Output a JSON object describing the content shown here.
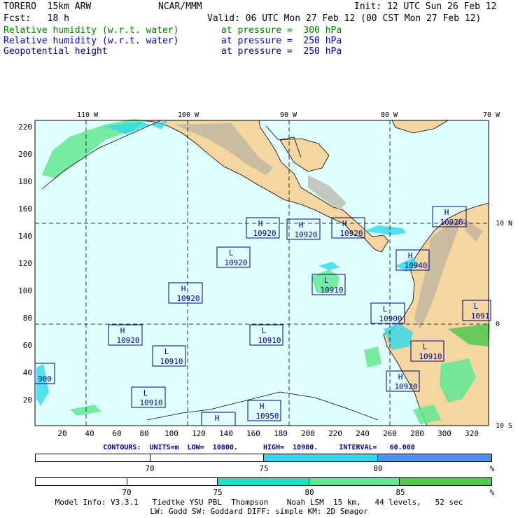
{
  "header": {
    "model": "TORERO  15km ARW",
    "org": "NCAR/MMM",
    "init": "Init: 12 UTC Sun 26 Feb 12",
    "fcst": "Fcst:   18 h",
    "valid": "Valid: 06 UTC Mon 27 Feb 12 (00 CST Mon 27 Feb 12)",
    "fields": [
      {
        "name": "Relative humidity (w.r.t. water)",
        "level": "at pressure =  300 hPa",
        "color": "#008000"
      },
      {
        "name": "Relative humidity (w.r.t. water)",
        "level": "at pressure =  250 hPa",
        "color": "#0000c0"
      },
      {
        "name": "Geopotential height",
        "level": "at pressure =  250 hPa",
        "color": "#000080"
      }
    ]
  },
  "map": {
    "lon_labels": [
      "110 W",
      "100 W",
      "90 W",
      "80 W",
      "70 W"
    ],
    "lat_labels": [
      "10 N",
      "0",
      "10 S"
    ],
    "y_ticks": [
      "220",
      "200",
      "180",
      "160",
      "140",
      "120",
      "100",
      "80",
      "60",
      "40",
      "20"
    ],
    "x_ticks": [
      "20",
      "40",
      "60",
      "80",
      "100",
      "120",
      "140",
      "160",
      "180",
      "200",
      "220",
      "240",
      "260",
      "280",
      "300",
      "320"
    ],
    "ocean_color": "#e0ffff",
    "land_color": "#f5d5a0",
    "highs_lows": [
      {
        "type": "H",
        "value": "10920"
      },
      {
        "type": "H",
        "value": "10920"
      },
      {
        "type": "H",
        "value": "10920"
      },
      {
        "type": "H",
        "value": "10920"
      },
      {
        "type": "L",
        "value": "10920"
      },
      {
        "type": "H",
        "value": "10940"
      },
      {
        "type": "L",
        "value": "10910"
      },
      {
        "type": "H",
        "value": "10920"
      },
      {
        "type": "L",
        "value": "10900"
      },
      {
        "type": "L",
        "value": "1091"
      },
      {
        "type": "H",
        "value": "10920"
      },
      {
        "type": "L",
        "value": "10910"
      },
      {
        "type": "L",
        "value": "10910"
      },
      {
        "type": "L",
        "value": "10910"
      },
      {
        "type": "",
        "value": "900"
      },
      {
        "type": "H",
        "value": "10920"
      },
      {
        "type": "L",
        "value": "10910"
      },
      {
        "type": "H",
        "value": "10950"
      },
      {
        "type": "H",
        "value": ""
      }
    ]
  },
  "contours_text": "CONTOURS:  UNITS=m  LOW=  10800.      HIGH=  10980.     INTERVAL=   60.000",
  "colorbar_250": {
    "labels": [
      "70",
      "75",
      "80",
      "%"
    ],
    "colors": [
      "#ffffff",
      "#ffffff",
      "#30d8e8",
      "#5090f0"
    ]
  },
  "colorbar_300": {
    "labels": [
      "70",
      "75",
      "80",
      "85",
      "%"
    ],
    "colors": [
      "#ffffff",
      "#ffffff",
      "#20e0c0",
      "#60e890",
      "#50c850"
    ]
  },
  "footer": {
    "line1": "Model Info: V3.3.1   Tiedtke YSU PBL  Thompson    Noah LSM  15 km,   44 levels,   52 sec",
    "line2": "LW: Godd SW: Goddard DIFF: simple KM: 2D Smagor"
  }
}
